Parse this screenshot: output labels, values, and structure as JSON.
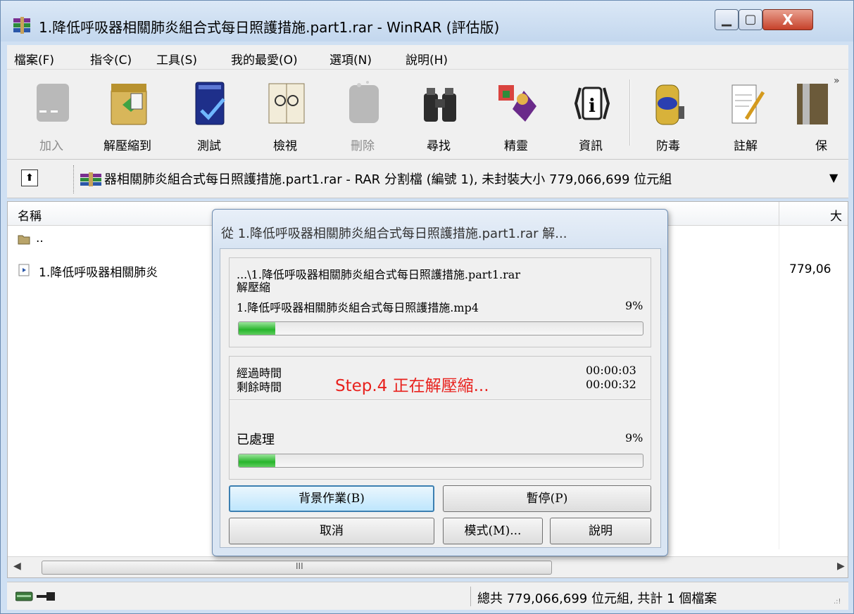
{
  "window": {
    "title": "1.降低呼吸器相關肺炎組合式每日照護措施.part1.rar - WinRAR (評估版)",
    "min_glyph": "▁",
    "max_glyph": "▢",
    "close_glyph": "X"
  },
  "menu": [
    "檔案(F)",
    "指令(C)",
    "工具(S)",
    "我的最愛(O)",
    "選項(N)",
    "說明(H)"
  ],
  "toolbar": {
    "items": [
      {
        "label": "加入",
        "icon": "add-archive-icon",
        "enabled": false
      },
      {
        "label": "解壓縮到",
        "icon": "extract-to-icon",
        "enabled": true
      },
      {
        "label": "測試",
        "icon": "test-icon",
        "enabled": true
      },
      {
        "label": "檢視",
        "icon": "view-icon",
        "enabled": true
      },
      {
        "label": "刪除",
        "icon": "delete-icon",
        "enabled": false
      },
      {
        "label": "尋找",
        "icon": "find-icon",
        "enabled": true
      },
      {
        "label": "精靈",
        "icon": "wizard-icon",
        "enabled": true
      },
      {
        "label": "資訊",
        "icon": "info-icon",
        "enabled": true
      },
      {
        "label": "防毒",
        "icon": "virus-scan-icon",
        "enabled": true
      },
      {
        "label": "註解",
        "icon": "comment-icon",
        "enabled": true
      },
      {
        "label": "保",
        "icon": "protect-icon",
        "enabled": true
      }
    ],
    "more": "»"
  },
  "address": {
    "up": "⬆",
    "text": "器相關肺炎組合式每日照護措施.part1.rar - RAR 分割檔 (編號 1), 未封裝大小 779,066,699 位元組",
    "dropdown": "▼"
  },
  "filelist": {
    "col_name": "名稱",
    "col_size": "大",
    "rows": [
      {
        "name": "..",
        "size": ""
      },
      {
        "name": "1.降低呼吸器相關肺炎",
        "size": "779,06"
      }
    ]
  },
  "scroll": {
    "left": "◀",
    "right": "▶",
    "grip": "III"
  },
  "status": {
    "text": "總共 779,066,699 位元組, 共計 1 個檔案",
    "grip": ".:!"
  },
  "dialog": {
    "title": "從 1.降低呼吸器相關肺炎組合式每日照護措施.part1.rar 解...",
    "archive_path": "...\\1.降低呼吸器相關肺炎組合式每日照護措施.part1.rar",
    "action": "解壓縮",
    "file_name": "1.降低呼吸器相關肺炎組合式每日照護措施.mp4",
    "file_percent": "9%",
    "file_progress": 0.09,
    "elapsed_label": "經過時間",
    "elapsed_value": "00:00:03",
    "remaining_label": "剩餘時間",
    "remaining_value": "00:00:32",
    "step_note": "Step.4  正在解壓縮...",
    "processed_label": "已處理",
    "processed_percent": "9%",
    "processed_progress": 0.09,
    "buttons": {
      "background": "背景作業(B)",
      "pause": "暫停(P)",
      "cancel": "取消",
      "mode": "模式(M)...",
      "help": "說明"
    }
  }
}
